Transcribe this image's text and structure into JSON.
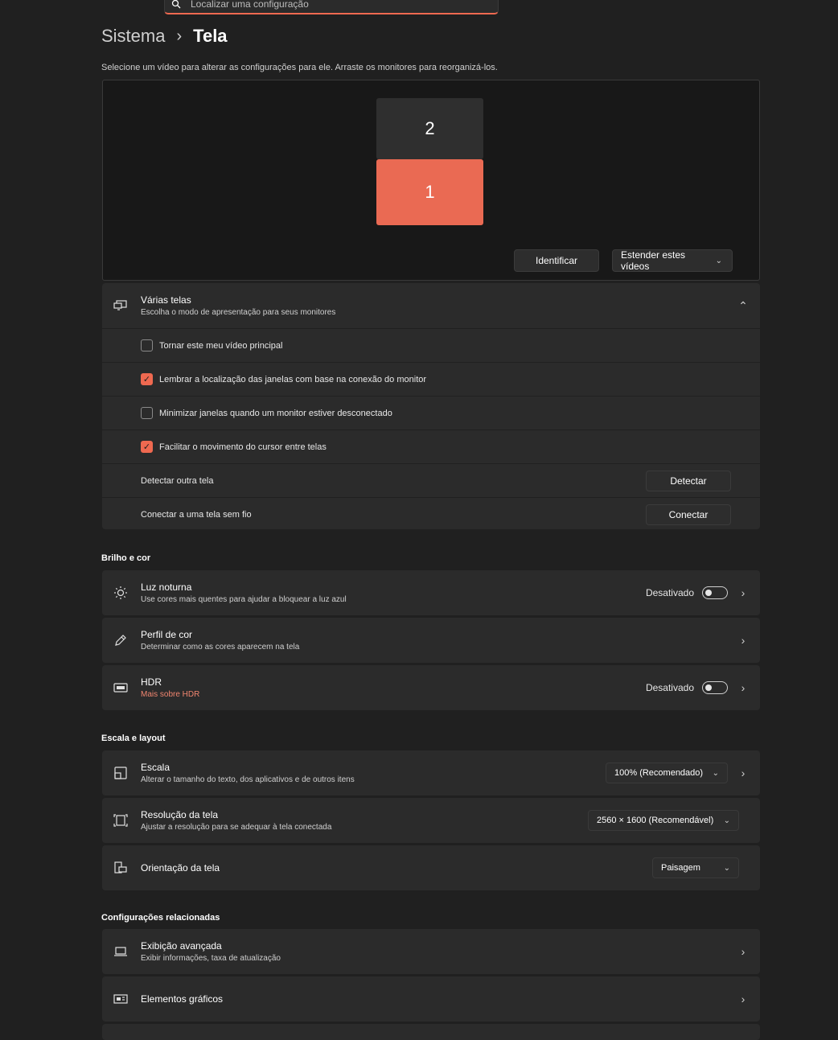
{
  "search": {
    "placeholder": "Localizar uma configuração"
  },
  "breadcrumb": {
    "parent": "Sistema",
    "separator": "›",
    "current": "Tela"
  },
  "hint": "Selecione um vídeo para alterar as configurações para ele. Arraste os monitores para reorganizá-los.",
  "monitors": {
    "secondary": "2",
    "primary": "1"
  },
  "monitor_actions": {
    "identify": "Identificar",
    "extend": "Estender estes vídeos"
  },
  "multiple_displays": {
    "title": "Várias telas",
    "subtitle": "Escolha o modo de apresentação para seus monitores",
    "options": [
      {
        "label": "Tornar este meu vídeo principal",
        "checked": false
      },
      {
        "label": "Lembrar a localização das janelas com base na conexão do monitor",
        "checked": true
      },
      {
        "label": "Minimizar janelas quando um monitor estiver desconectado",
        "checked": false
      },
      {
        "label": "Facilitar o movimento do cursor entre telas",
        "checked": true
      }
    ],
    "detect_label": "Detectar outra tela",
    "detect_button": "Detectar",
    "connect_label": "Conectar a uma tela sem fio",
    "connect_button": "Conectar"
  },
  "brightness_section": {
    "title": "Brilho e cor",
    "night_light": {
      "title": "Luz noturna",
      "subtitle": "Use cores mais quentes para ajudar a bloquear a luz azul",
      "state": "Desativado"
    },
    "color_profile": {
      "title": "Perfil de cor",
      "subtitle": "Determinar como as cores aparecem na tela"
    },
    "hdr": {
      "title": "HDR",
      "link": "Mais sobre HDR",
      "state": "Desativado"
    }
  },
  "scale_section": {
    "title": "Escala e layout",
    "scale": {
      "title": "Escala",
      "subtitle": "Alterar o tamanho do texto, dos aplicativos e de outros itens",
      "value": "100% (Recomendado)"
    },
    "resolution": {
      "title": "Resolução da tela",
      "subtitle": "Ajustar a resolução para se adequar à tela conectada",
      "value": "2560 × 1600 (Recomendável)"
    },
    "orientation": {
      "title": "Orientação da tela",
      "value": "Paisagem"
    }
  },
  "related_section": {
    "title": "Configurações relacionadas",
    "advanced": {
      "title": "Exibição avançada",
      "subtitle": "Exibir informações, taxa de atualização"
    },
    "graphics": {
      "title": "Elementos gráficos"
    }
  },
  "colors": {
    "accent": "#ef6950",
    "background": "#202020",
    "card": "#2b2b2b",
    "primary_monitor": "#ea6a53"
  }
}
